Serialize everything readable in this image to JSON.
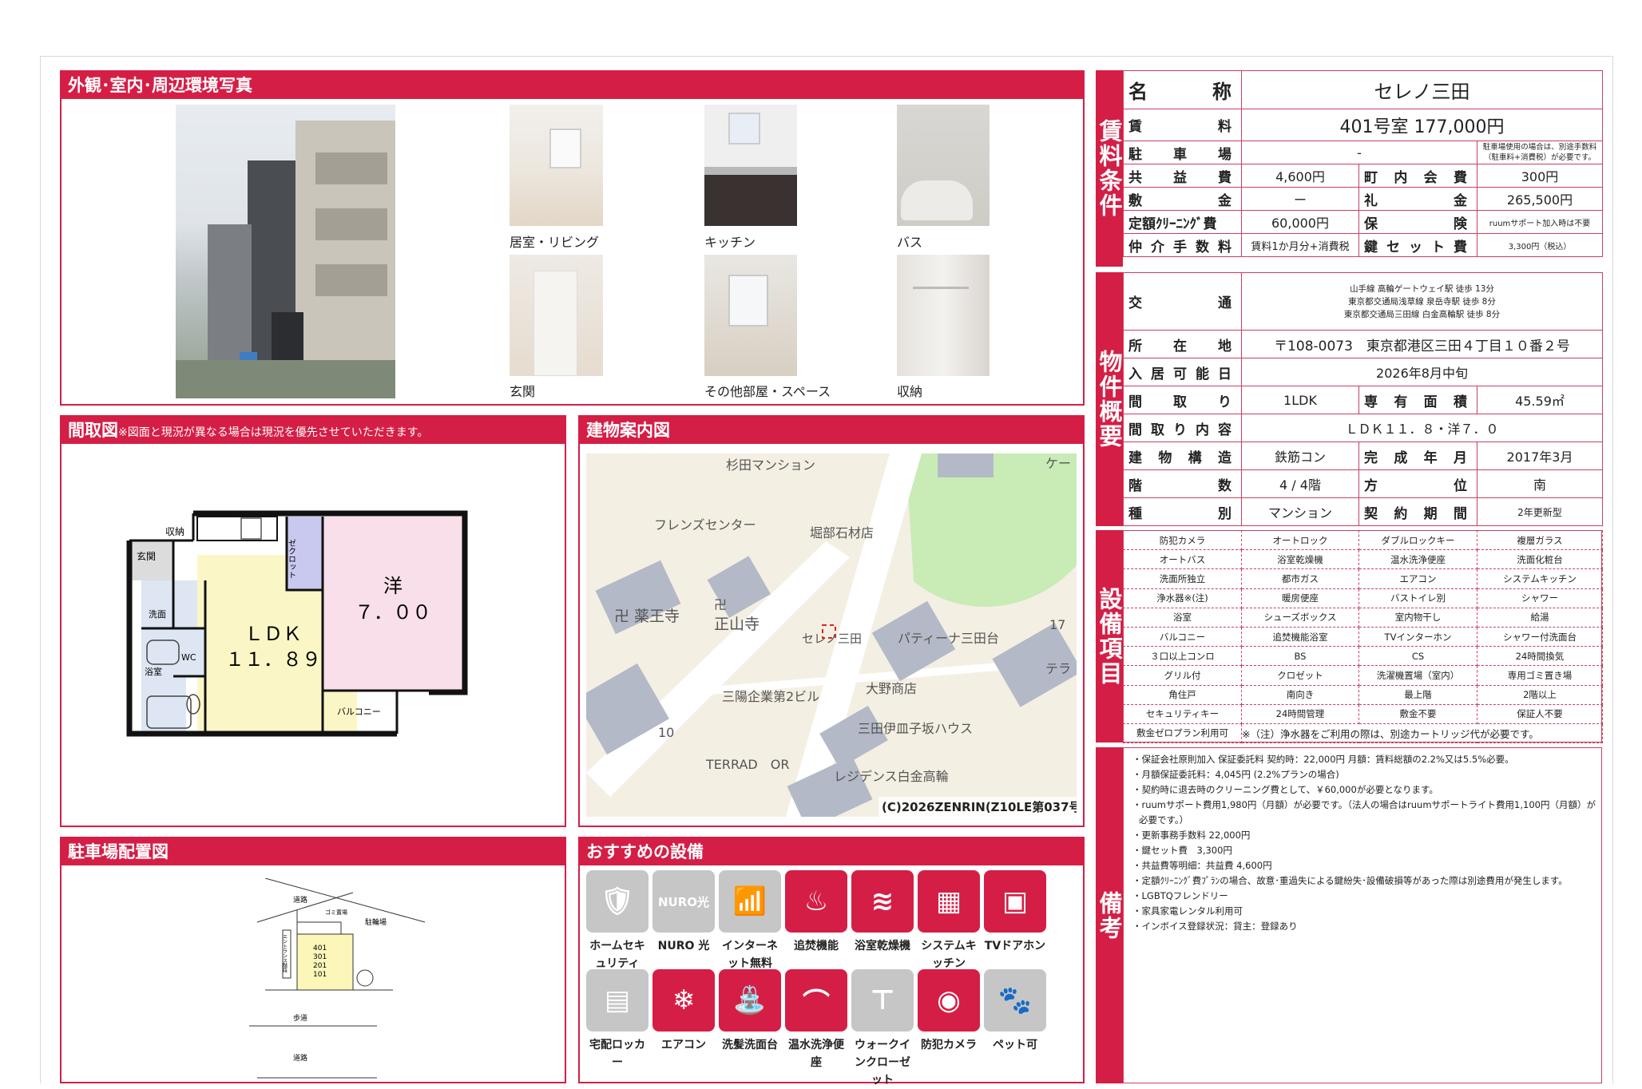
{
  "property_name": "セレノ三田",
  "photos": {
    "header": "外観･室内･周辺環境写真",
    "captions": [
      "居室・リビング",
      "キッチン",
      "バス",
      "玄関",
      "その他部屋・スペース",
      "収納"
    ]
  },
  "floorplan": {
    "header": "間取図",
    "note": "※図面と現況が異なる場合は現況を優先させていただきます。",
    "labels": {
      "storage": "収納",
      "closet": "ゼクロット",
      "entrance": "玄関",
      "wash": "洗面",
      "bath": "浴室",
      "wc": "WC",
      "ldk": "ＬＤＫ",
      "ldk_size": "１１．８９",
      "western": "洋",
      "western_size": "７．００",
      "balcony": "バルコニー"
    }
  },
  "building_map": {
    "header": "建物案内図",
    "labels": [
      "杉田マンション",
      "フレンズセンター",
      "堀部石材店",
      "卍 薬王寺",
      "卍",
      "正山寺",
      "セレノ三田",
      "パティーナ三田台",
      "三陽企業第2ビル",
      "大野商店",
      "三田伊皿子坂ハウス",
      "TERRAD　OR",
      "レジデンス白金高輪",
      "ケー",
      "テラ",
      "17",
      "10"
    ],
    "copyright": "(C)2026ZENRIN(Z10LE第037号)"
  },
  "parking": {
    "header": "駐車場配置図",
    "labels": {
      "road_top": "道路",
      "garbage": "ゴミ置場",
      "parking": "駐輪場",
      "entrance": "エントランス階段",
      "units": [
        "401",
        "301",
        "201",
        "101"
      ],
      "sidewalk": "歩道",
      "road_bottom": "道路"
    }
  },
  "recommended": {
    "header": "おすすめの設備",
    "items": [
      {
        "label": "ホームセキュリティ",
        "icon": "shield-icon",
        "on": false
      },
      {
        "label": "NURO 光",
        "icon": "nuro-icon",
        "on": false
      },
      {
        "label": "インターネット無料",
        "icon": "wifi-icon",
        "on": false
      },
      {
        "label": "追焚機能",
        "icon": "bathtub-icon",
        "on": true
      },
      {
        "label": "浴室乾燥機",
        "icon": "bath-dryer-icon",
        "on": true
      },
      {
        "label": "システムキッチン",
        "icon": "kitchen-icon",
        "on": true
      },
      {
        "label": "TVドアホン",
        "icon": "intercom-icon",
        "on": true
      },
      {
        "label": "宅配ロッカー",
        "icon": "delivery-locker-icon",
        "on": false
      },
      {
        "label": "エアコン",
        "icon": "aircon-icon",
        "on": true
      },
      {
        "label": "洗髪洗面台",
        "icon": "washbasin-icon",
        "on": true
      },
      {
        "label": "温水洗浄便座",
        "icon": "toilet-icon",
        "on": true
      },
      {
        "label": "ウォークインクローゼット",
        "icon": "closet-icon",
        "on": false
      },
      {
        "label": "防犯カメラ",
        "icon": "camera-icon",
        "on": true
      },
      {
        "label": "ペット可",
        "icon": "paw-icon",
        "on": false
      }
    ]
  },
  "rent": {
    "side": "賃料条件",
    "name_label": "名　　称",
    "rent_label": "賃　料",
    "rent_value": "401号室 177,000円",
    "parking_label": "駐車場",
    "parking_value": "-",
    "parking_note": "駐車場使用の場合は、別途手数料（駐車料+消費税）が必要です。",
    "common_label": "共益費",
    "common_value": "4,600円",
    "town_label": "町内会費",
    "town_value": "300円",
    "deposit_label": "敷金",
    "deposit_value": "ー",
    "key_money_label": "礼金",
    "key_money_value": "265,500円",
    "cleaning_label": "定額ｸﾘｰﾆﾝｸﾞ費",
    "cleaning_value": "60,000円",
    "insurance_label": "保険",
    "insurance_value": "ruumサポート加入時は不要",
    "brokerage_label": "仲介手数料",
    "brokerage_value": "賃料1か月分+消費税",
    "key_set_label": "鍵セット費",
    "key_set_value": "3,300円（税込）"
  },
  "overview": {
    "side": "物件概要",
    "traffic_label": "交通",
    "traffic_lines": [
      "山手線 高輪ゲートウェイ駅 徒歩 13分",
      "東京都交通局浅草線 泉岳寺駅 徒歩 8分",
      "東京都交通局三田線 白金高輪駅 徒歩 8分"
    ],
    "address_label": "所在地",
    "address_value": "〒108-0073　東京都港区三田４丁目１０番２号",
    "move_in_label": "入居可能日",
    "move_in_value": "2026年8月中旬",
    "layout_label": "間取り",
    "layout_value": "1LDK",
    "area_label": "専有面積",
    "area_value": "45.59㎡",
    "layout_detail_label": "間取り内容",
    "layout_detail_value": "ＬＤＫ１１．８・洋７．０",
    "structure_label": "建物構造",
    "structure_value": "鉄筋コン",
    "completed_label": "完成年月",
    "completed_value": "2017年3月",
    "floor_label": "階数",
    "floor_value": "4 / 4階",
    "direction_label": "方位",
    "direction_value": "南",
    "type_label": "種別",
    "type_value": "マンション",
    "contract_label": "契約期間",
    "contract_value": "2年更新型"
  },
  "equipment": {
    "side": "設備項目",
    "grid": [
      [
        "防犯カメラ",
        "オートロック",
        "ダブルロックキー",
        "複層ガラス"
      ],
      [
        "オートバス",
        "浴室乾燥機",
        "温水洗浄便座",
        "洗面化粧台"
      ],
      [
        "洗面所独立",
        "都市ガス",
        "エアコン",
        "システムキッチン"
      ],
      [
        "浄水器※(注)",
        "暖房便座",
        "バストイレ別",
        "シャワー"
      ],
      [
        "浴室",
        "シューズボックス",
        "室内物干し",
        "給湯"
      ],
      [
        "バルコニー",
        "追焚機能浴室",
        "TVインターホン",
        "シャワー付洗面台"
      ],
      [
        "３口以上コンロ",
        "BS",
        "CS",
        "24時間換気"
      ],
      [
        "グリル付",
        "クロゼット",
        "洗濯機置場（室内）",
        "専用ゴミ置き場"
      ],
      [
        "角住戸",
        "南向き",
        "最上階",
        "2階以上"
      ],
      [
        "セキュリティキー",
        "24時間管理",
        "敷金不要",
        "保証人不要"
      ]
    ],
    "last_label": "敷金ゼロプラン利用可",
    "last_note": "※（注）浄水器をご利用の際は、別途カートリッジ代が必要です。"
  },
  "remarks": {
    "side": "備考",
    "lines": [
      "・保証会社原則加入 保証委託料 契約時：22,000円 月額：賃料総額の2.2%又は5.5%必要。",
      "・月額保証委託料：4,045円 (2.2%プランの場合)",
      "・契約時に退去時のクリーニング費として、￥60,000が必要となります。",
      "・ruumサポート費用1,980円（月額）が必要です。（法人の場合はruumサポートライト費用1,100円（月額）が必要です。）",
      "・更新事務手数料 22,000円",
      "・鍵セット費　3,300円",
      "・共益費等明細：共益費 4,600円",
      "・定額ｸﾘｰﾆﾝｸﾞ費ﾌﾟﾗﾝの場合、故意･重過失による鍵紛失･設備破損等があった際は別途費用が発生します。",
      "・LGBTQフレンドリー",
      "・家具家電レンタル利用可",
      "・インボイス登録状況：貸主：登録あり"
    ]
  }
}
